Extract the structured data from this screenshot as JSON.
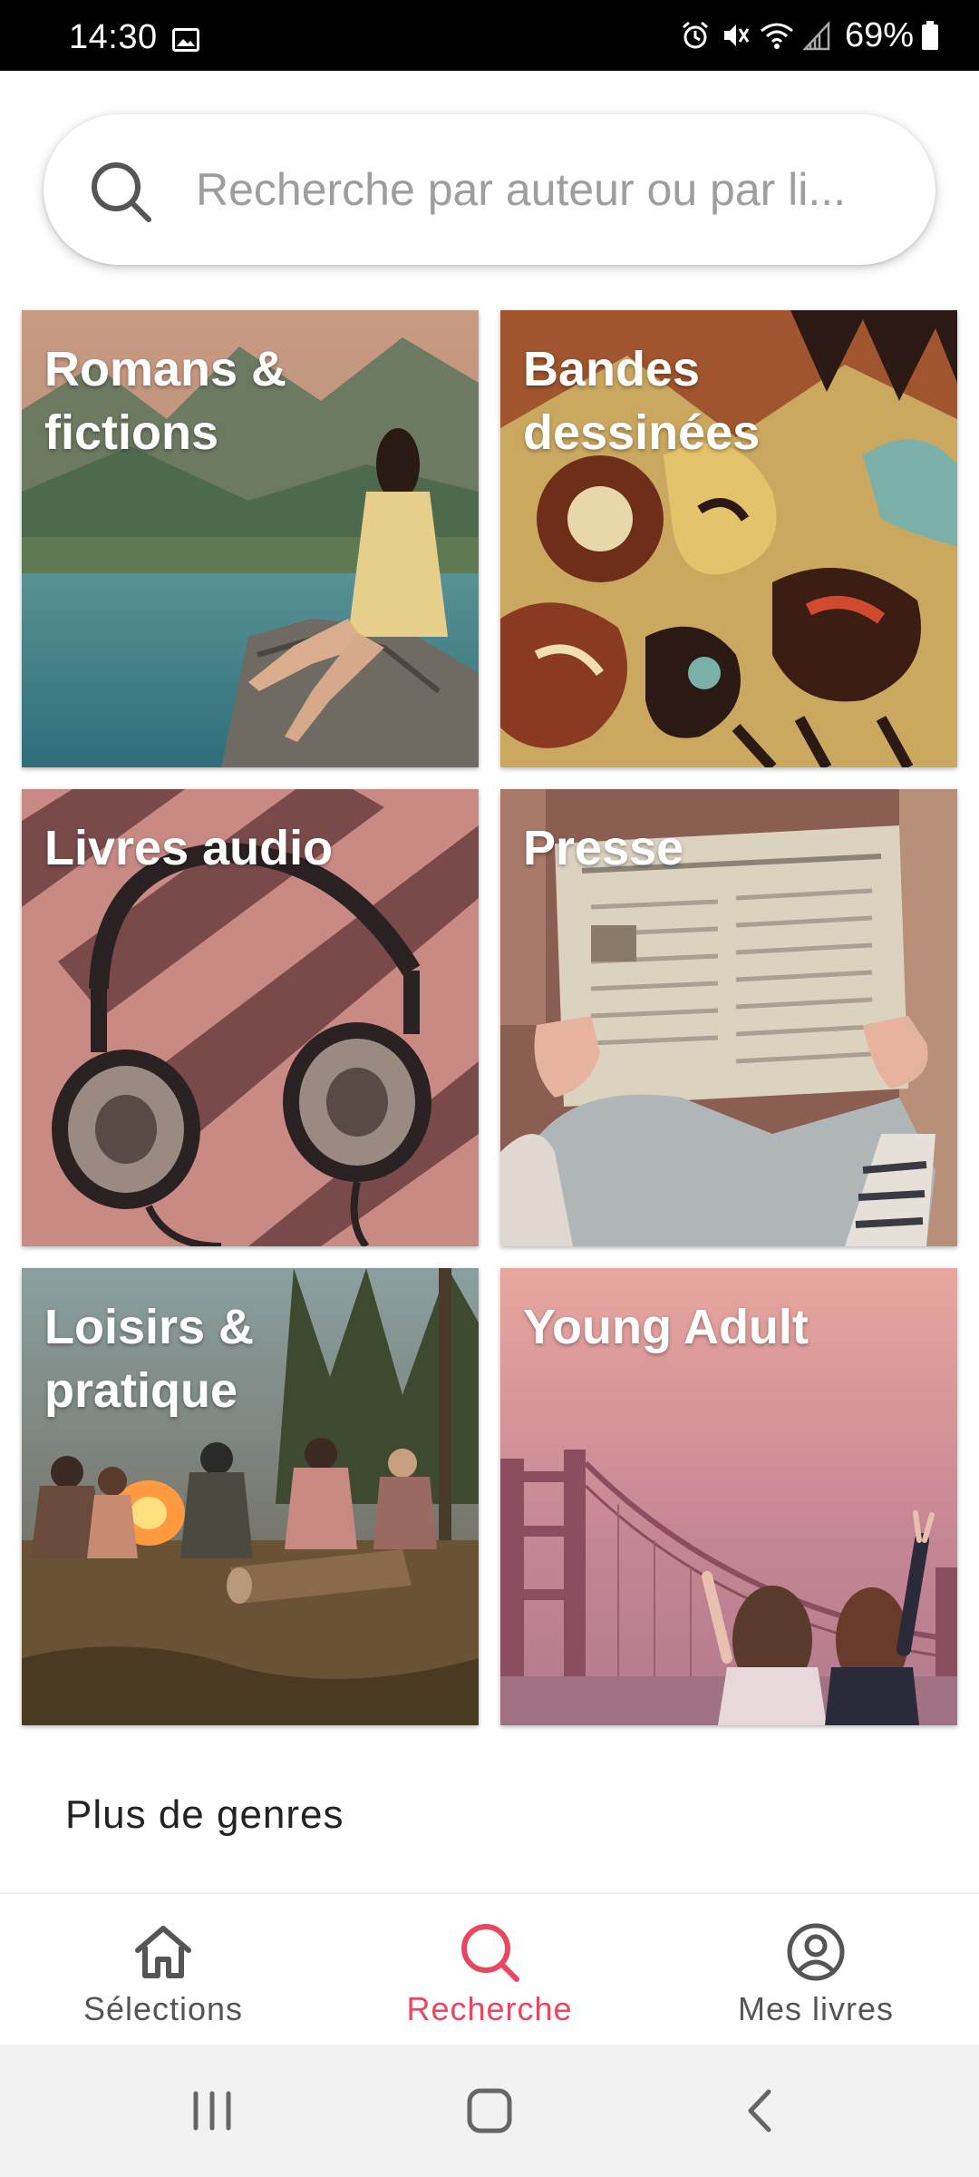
{
  "status_bar": {
    "time": "14:30",
    "battery": "69%",
    "icons": [
      "gallery-icon",
      "alarm-icon",
      "mute-icon",
      "wifi-icon",
      "signal-icon",
      "battery-icon"
    ]
  },
  "search": {
    "placeholder": "Recherche par auteur ou par li...",
    "value": "",
    "icon": "search-icon"
  },
  "categories": [
    {
      "title": "Romans & fictions",
      "image": "lake-reader"
    },
    {
      "title": "Bandes dessinées",
      "image": "graffiti"
    },
    {
      "title": "Livres audio",
      "image": "headphones"
    },
    {
      "title": "Presse",
      "image": "newspaper"
    },
    {
      "title": "Loisirs & pratique",
      "image": "campfire"
    },
    {
      "title": "Young Adult",
      "image": "bridge-friends"
    }
  ],
  "more_genres": "Plus de genres",
  "bottom_nav": {
    "items": [
      {
        "label": "Sélections",
        "icon": "home-icon",
        "active": false
      },
      {
        "label": "Recherche",
        "icon": "search-icon",
        "active": true
      },
      {
        "label": "Mes livres",
        "icon": "account-icon",
        "active": false
      }
    ]
  },
  "system_nav": [
    "recent-apps",
    "home",
    "back"
  ],
  "colors": {
    "accent": "#e8475f",
    "status_bar": "#000000",
    "system_nav_bg": "#f2f2f2"
  }
}
